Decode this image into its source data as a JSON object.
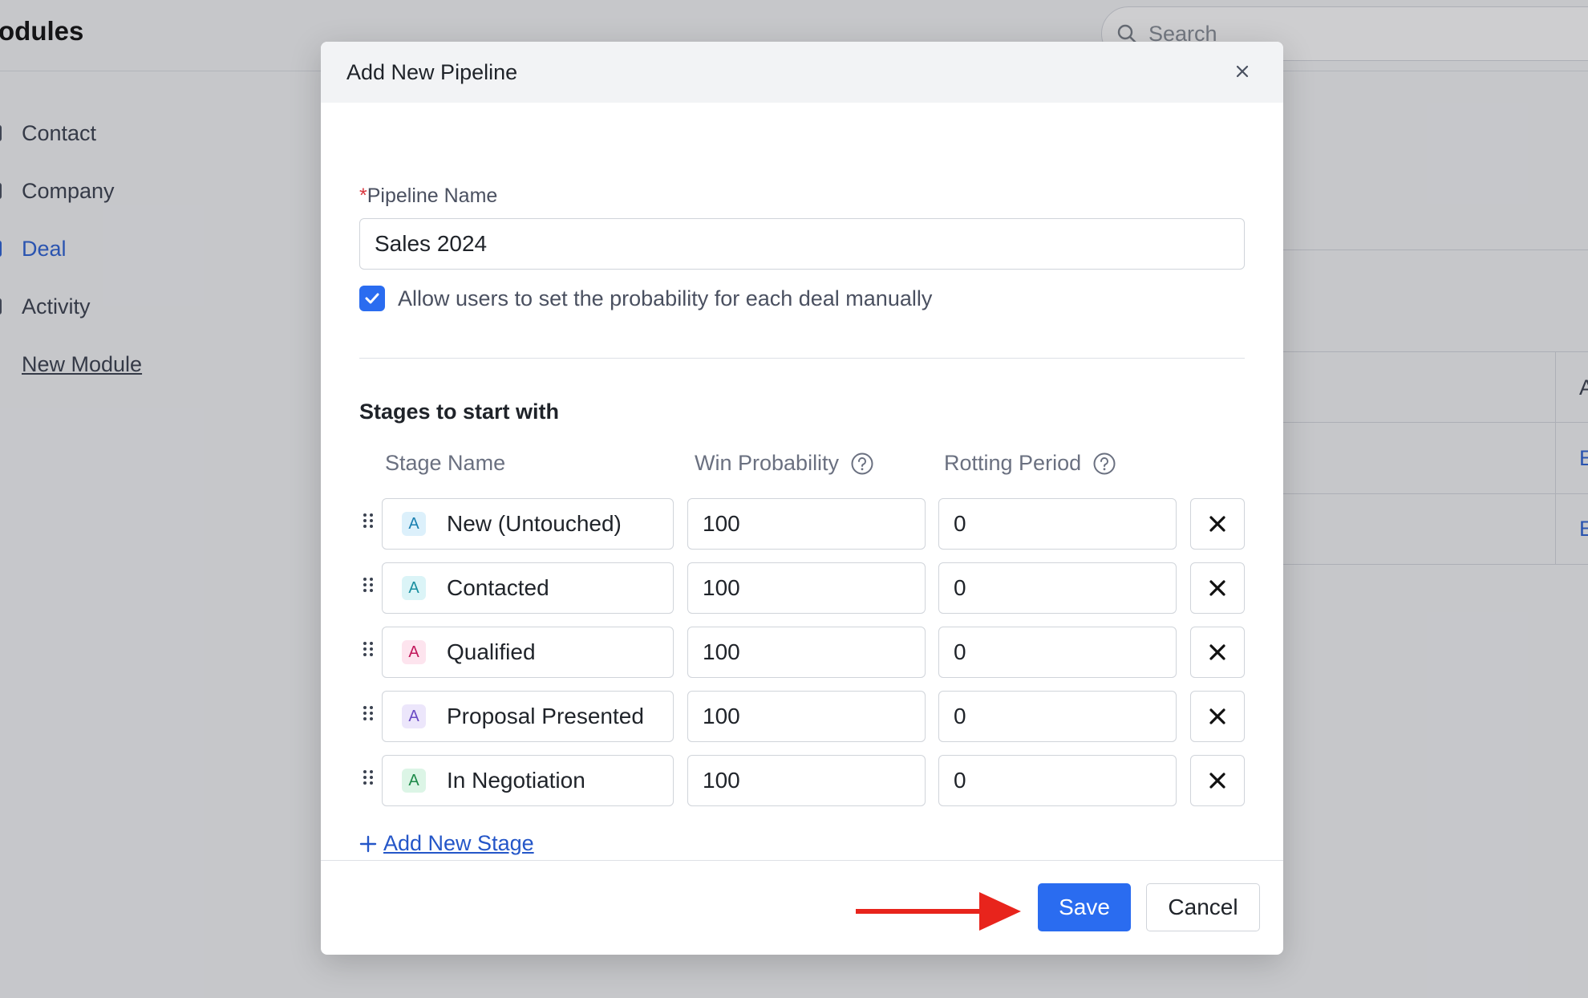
{
  "background": {
    "title": "odules",
    "search_placeholder": "Search",
    "nav": [
      {
        "label": "Contact"
      },
      {
        "label": "Company"
      },
      {
        "label": "Deal"
      },
      {
        "label": "Activity"
      },
      {
        "label": "New Module"
      }
    ],
    "cells": [
      "A",
      "E",
      "E"
    ]
  },
  "modal": {
    "title": "Add New Pipeline",
    "pipeline_name_label": "Pipeline Name",
    "required_marker": "*",
    "pipeline_name_value": "Sales 2024",
    "checkbox_label": "Allow users to set the probability for each deal manually",
    "checkbox_checked": true,
    "section_title": "Stages to start with",
    "columns": {
      "stage_name": "Stage Name",
      "win_probability": "Win Probability",
      "rotting_period": "Rotting Period"
    },
    "stages": [
      {
        "badge": "A",
        "name": "New (Untouched)",
        "probability": "100",
        "rotting": "0",
        "badge_color": "#1a7fb0",
        "badge_bg": "#dcf0fb"
      },
      {
        "badge": "A",
        "name": "Contacted",
        "probability": "100",
        "rotting": "0",
        "badge_color": "#1a8fa0",
        "badge_bg": "#dbf4f7"
      },
      {
        "badge": "A",
        "name": "Qualified",
        "probability": "100",
        "rotting": "0",
        "badge_color": "#c2185b",
        "badge_bg": "#fde4ee"
      },
      {
        "badge": "A",
        "name": "Proposal Presented",
        "probability": "100",
        "rotting": "0",
        "badge_color": "#6a4bc4",
        "badge_bg": "#ece6fb"
      },
      {
        "badge": "A",
        "name": "In Negotiation",
        "probability": "100",
        "rotting": "0",
        "badge_color": "#1e8a4a",
        "badge_bg": "#dcf5e6"
      }
    ],
    "add_stage_label": "Add New Stage",
    "save_label": "Save",
    "cancel_label": "Cancel"
  },
  "colors": {
    "primary": "#2a6cf0",
    "annotation_arrow": "#e8241c",
    "required": "#d9363e"
  }
}
